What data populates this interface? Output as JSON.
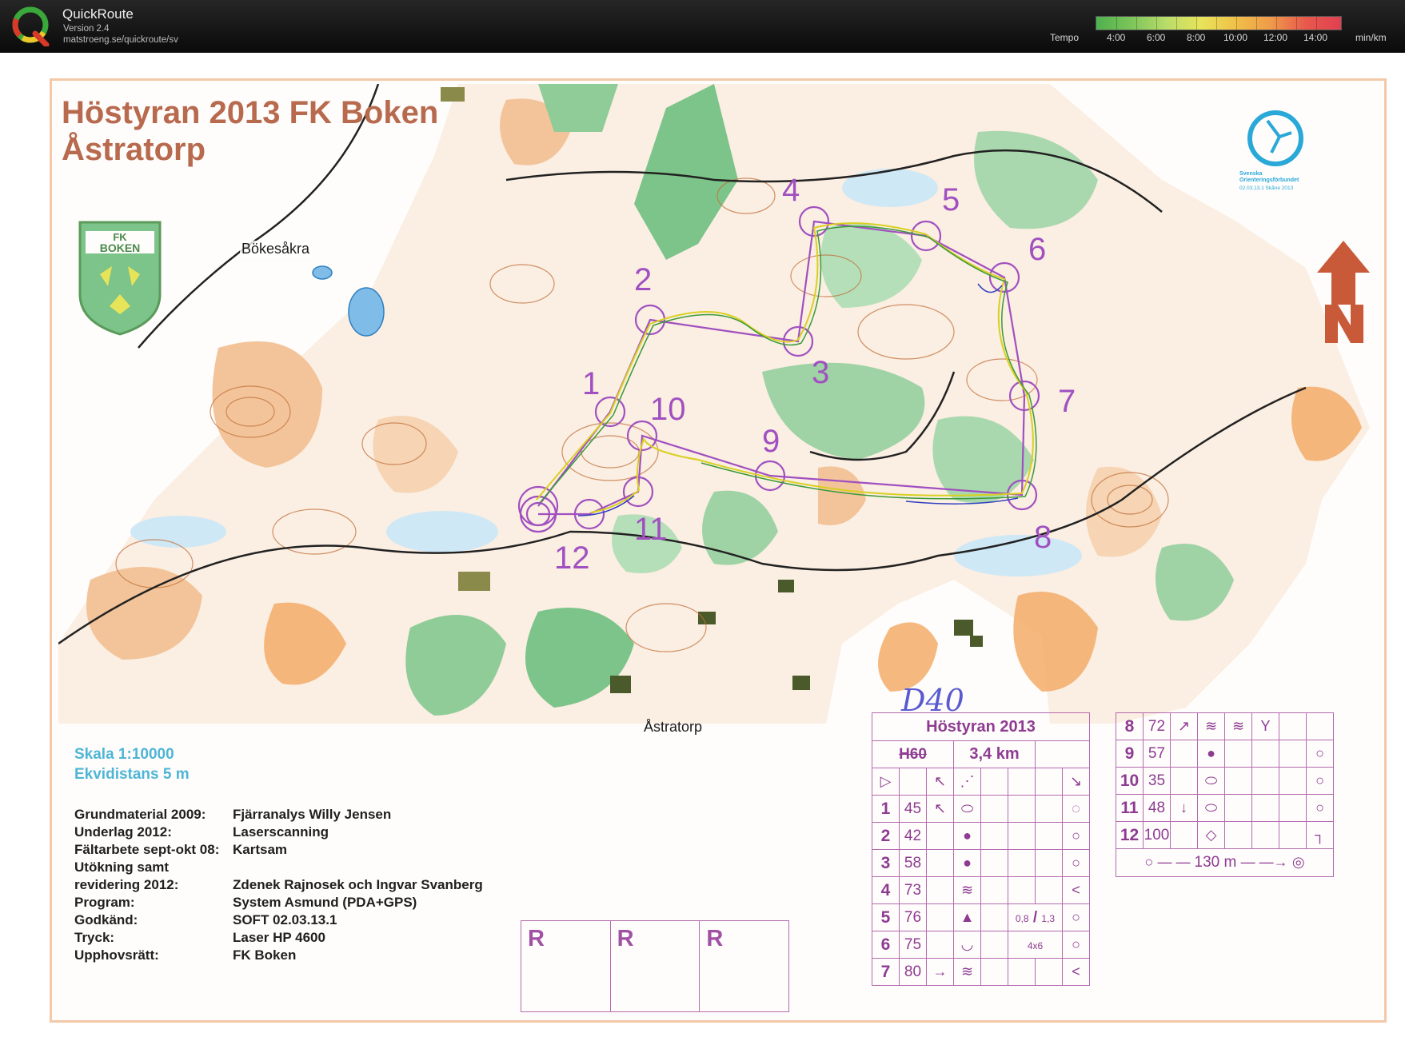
{
  "app": {
    "name": "QuickRoute",
    "version": "Version 2.4",
    "url": "matstroeng.se/quickroute/sv",
    "logo_icon": "quickroute-q-icon"
  },
  "tempo": {
    "label": "Tempo",
    "ticks": [
      "4:00",
      "6:00",
      "8:00",
      "10:00",
      "12:00",
      "14:00"
    ],
    "unit": "min/km",
    "colors": [
      "#4fb04f",
      "#b9dc6a",
      "#e8e45a",
      "#ef9a4a",
      "#e04050"
    ]
  },
  "map": {
    "title": "Höstyran 2013 FK Boken",
    "subtitle": "Åstratorp",
    "crest_text_1": "FK",
    "crest_text_2": "BOKEN",
    "sof_logo_lines": [
      "Svenska",
      "Orienteringsförbundet",
      "02.03.13.1    Skåne 2013"
    ],
    "places": {
      "bokesakra": "Bökesåkra",
      "astratorp": "Åstratorp"
    },
    "control_numbers": [
      "1",
      "2",
      "3",
      "4",
      "5",
      "6",
      "7",
      "8",
      "9",
      "10",
      "11",
      "12"
    ],
    "colors": {
      "course": "#a050c0",
      "route_yellow": "#d8d020",
      "route_green": "#3a9a3a",
      "route_red": "#e04040",
      "route_blue": "#3040c0",
      "contour": "#c0703a",
      "forest_green": "#5fb070",
      "water": "#60a8e0",
      "open_land": "#f2a860"
    }
  },
  "legend": {
    "scale": "Skala 1:10000",
    "contour": "Ekvidistans 5 m",
    "credits": [
      {
        "label": "Grundmaterial 2009:",
        "value": "Fjärranalys Willy Jensen"
      },
      {
        "label": "Underlag 2012:",
        "value": "Laserscanning"
      },
      {
        "label": "Fältarbete sept-okt 08:",
        "value": "Kartsam"
      },
      {
        "label": "Utökning samt",
        "value": ""
      },
      {
        "label": "revidering 2012:",
        "value": "Zdenek Rajnosek och Ingvar Svanberg"
      },
      {
        "label": "Program:",
        "value": "System Asmund (PDA+GPS)"
      },
      {
        "label": "Godkänd:",
        "value": "SOFT 02.03.13.1"
      },
      {
        "label": "Tryck:",
        "value": "Laser HP 4600"
      },
      {
        "label": "Upphovsrätt:",
        "value": "FK Boken"
      }
    ]
  },
  "r_boxes": [
    "R",
    "R",
    "R"
  ],
  "handwritten_class": "D40",
  "descriptions": {
    "event": "Höstyran 2013",
    "class_crossed": "H60",
    "distance": "3,4 km",
    "controls": [
      {
        "num": "1",
        "code": "45"
      },
      {
        "num": "2",
        "code": "42"
      },
      {
        "num": "3",
        "code": "58"
      },
      {
        "num": "4",
        "code": "73"
      },
      {
        "num": "5",
        "code": "76"
      },
      {
        "num": "6",
        "code": "75"
      },
      {
        "num": "7",
        "code": "80"
      },
      {
        "num": "8",
        "code": "72"
      },
      {
        "num": "9",
        "code": "57"
      },
      {
        "num": "10",
        "code": "35"
      },
      {
        "num": "11",
        "code": "48"
      },
      {
        "num": "12",
        "code": "100"
      }
    ],
    "size_5_top": "0,8",
    "size_5_bottom": "1,3",
    "size_6": "4x6",
    "finish_distance": "130 m"
  }
}
